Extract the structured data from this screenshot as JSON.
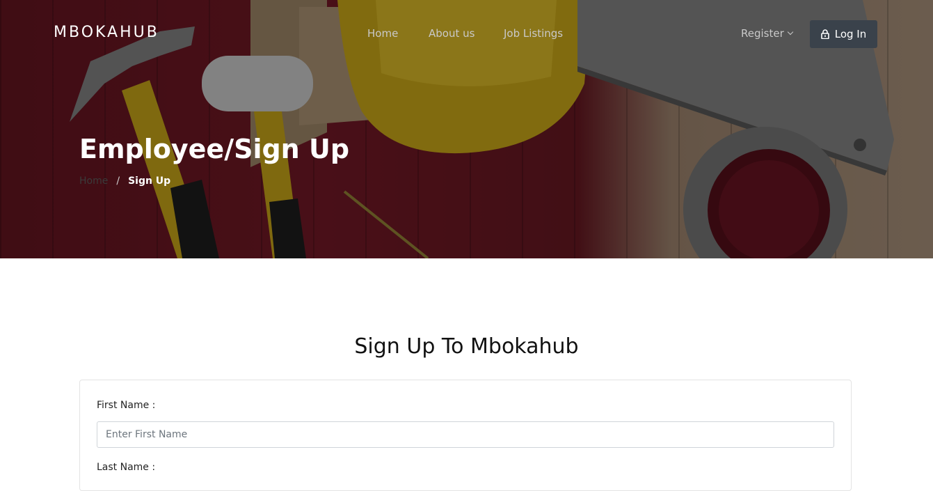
{
  "nav": {
    "brand": "MBOKAHUB",
    "links": [
      {
        "label": "Home"
      },
      {
        "label": "About us"
      },
      {
        "label": "Job Listings"
      }
    ],
    "register_label": "Register",
    "login_label": "Log In"
  },
  "hero": {
    "title": "Employee/Sign Up",
    "breadcrumb": {
      "home": "Home",
      "separator": "/",
      "current": "Sign Up"
    }
  },
  "form": {
    "heading": "Sign Up To Mbokahub",
    "first_name": {
      "label": "First Name :",
      "placeholder": "Enter First Name",
      "value": ""
    },
    "last_name": {
      "label": "Last Name :"
    }
  },
  "icons": {
    "login": "lock-icon",
    "register": "chevron-down-icon"
  }
}
